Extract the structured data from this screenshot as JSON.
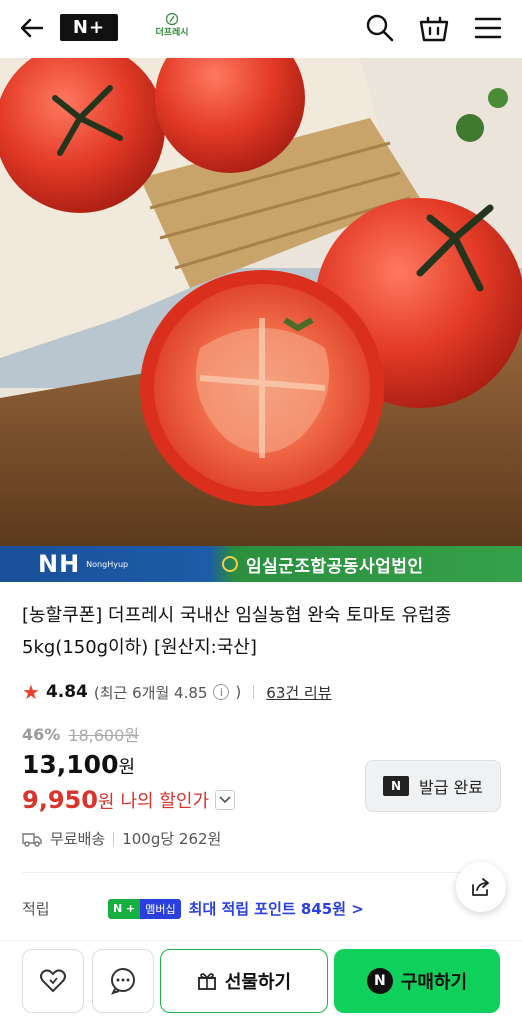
{
  "header": {
    "nplus_logo": "N+",
    "brand_name": "더프레시",
    "icons": [
      "back-arrow-icon",
      "search-icon",
      "basket-icon",
      "menu-icon"
    ]
  },
  "hero": {
    "banner_logo": "NH",
    "banner_logo_sub": "NongHyup",
    "banner_org": "임실군조합공동사업법인"
  },
  "product": {
    "title": "[농할쿠폰] 더프레시 국내산 임실농협 완숙 토마토 유럽종 5kg(150g이하) [원산지:국산]",
    "rating": "4.84",
    "recent_rating": "(최근 6개월 4.85",
    "info_icon": "i",
    "recent_close": ")",
    "review_count": "63건 리뷰",
    "discount_rate": "46%",
    "original_price": "18,600원",
    "price_value": "13,100",
    "price_unit": "원",
    "my_price_value": "9,950",
    "my_price_unit": "원",
    "my_price_label": "나의 할인가",
    "coupon_badge": "N",
    "coupon_button": "발급 완료",
    "shipping": "무료배송",
    "unit_price": "100g당 262원"
  },
  "points": {
    "label": "적립",
    "badge_n": "N + ",
    "badge_member": "멤버십",
    "text": "최대 적립 포인트 845원 >"
  },
  "bottom_bar": {
    "gift_label": "선물하기",
    "buy_badge": "N",
    "buy_label": "구매하기"
  },
  "colors": {
    "accent_green": "#0fd05a",
    "sale_red": "#d9332a",
    "point_blue": "#2a3fe0",
    "star": "#e8412c"
  }
}
